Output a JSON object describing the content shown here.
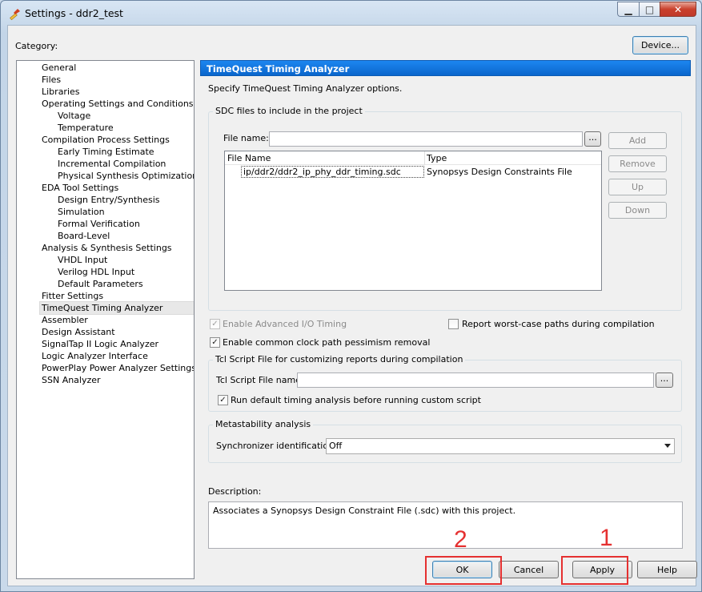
{
  "window": {
    "title": "Settings - ddr2_test",
    "min_icon": "minimize-icon",
    "max_icon": "maximize-icon",
    "close_icon": "close-icon"
  },
  "header": {
    "category_label": "Category:",
    "device_button": "Device..."
  },
  "tree": {
    "items": [
      {
        "label": "General",
        "level": 1
      },
      {
        "label": "Files",
        "level": 1
      },
      {
        "label": "Libraries",
        "level": 1
      },
      {
        "label": "Operating Settings and Conditions",
        "level": 1
      },
      {
        "label": "Voltage",
        "level": 2
      },
      {
        "label": "Temperature",
        "level": 2
      },
      {
        "label": "Compilation Process Settings",
        "level": 1
      },
      {
        "label": "Early Timing Estimate",
        "level": 2
      },
      {
        "label": "Incremental Compilation",
        "level": 2
      },
      {
        "label": "Physical Synthesis Optimizations",
        "level": 2
      },
      {
        "label": "EDA Tool Settings",
        "level": 1
      },
      {
        "label": "Design Entry/Synthesis",
        "level": 2
      },
      {
        "label": "Simulation",
        "level": 2
      },
      {
        "label": "Formal Verification",
        "level": 2
      },
      {
        "label": "Board-Level",
        "level": 2
      },
      {
        "label": "Analysis & Synthesis Settings",
        "level": 1
      },
      {
        "label": "VHDL Input",
        "level": 2
      },
      {
        "label": "Verilog HDL Input",
        "level": 2
      },
      {
        "label": "Default Parameters",
        "level": 2
      },
      {
        "label": "Fitter Settings",
        "level": 1
      },
      {
        "label": "TimeQuest Timing Analyzer",
        "level": 1,
        "selected": true
      },
      {
        "label": "Assembler",
        "level": 1
      },
      {
        "label": "Design Assistant",
        "level": 1
      },
      {
        "label": "SignalTap II Logic Analyzer",
        "level": 1
      },
      {
        "label": "Logic Analyzer Interface",
        "level": 1
      },
      {
        "label": "PowerPlay Power Analyzer Settings",
        "level": 1
      },
      {
        "label": "SSN Analyzer",
        "level": 1
      }
    ]
  },
  "panel": {
    "header": "TimeQuest Timing Analyzer",
    "intro": "Specify TimeQuest Timing Analyzer options.",
    "sdc": {
      "group_title": "SDC files to include in the project",
      "file_name_label": "File name:",
      "file_name_value": "",
      "browse": "...",
      "columns": [
        "File Name",
        "Type"
      ],
      "rows": [
        {
          "file": "ip/ddr2/ddr2_ip_phy_ddr_timing.sdc",
          "type": "Synopsys Design Constraints File"
        }
      ],
      "buttons": {
        "add": "Add",
        "remove": "Remove",
        "up": "Up",
        "down": "Down"
      }
    },
    "options": {
      "advanced_io": {
        "label": "Enable Advanced I/O Timing",
        "checked": true,
        "enabled": false
      },
      "worst_case": {
        "label": "Report worst-case paths during compilation",
        "checked": false
      },
      "clock_pessimism": {
        "label": "Enable common clock path pessimism removal",
        "checked": true
      }
    },
    "tcl": {
      "group_title": "Tcl Script File for customizing reports during compilation",
      "file_label": "Tcl Script File name:",
      "file_value": "",
      "browse": "...",
      "run_default": {
        "label": "Run default timing analysis before running custom script",
        "checked": true
      }
    },
    "meta": {
      "group_title": "Metastability analysis",
      "sync_label": "Synchronizer identification:",
      "sync_value": "Off"
    },
    "description": {
      "label": "Description:",
      "text": "Associates a Synopsys Design Constraint File (.sdc) with this project."
    }
  },
  "footer": {
    "ok": "OK",
    "cancel": "Cancel",
    "apply": "Apply",
    "help": "Help"
  },
  "annotations": {
    "one": "1",
    "two": "2",
    "color": "#e53030"
  },
  "colors": {
    "header_blue": "#0a66cc",
    "red_annotation": "#e53030"
  }
}
